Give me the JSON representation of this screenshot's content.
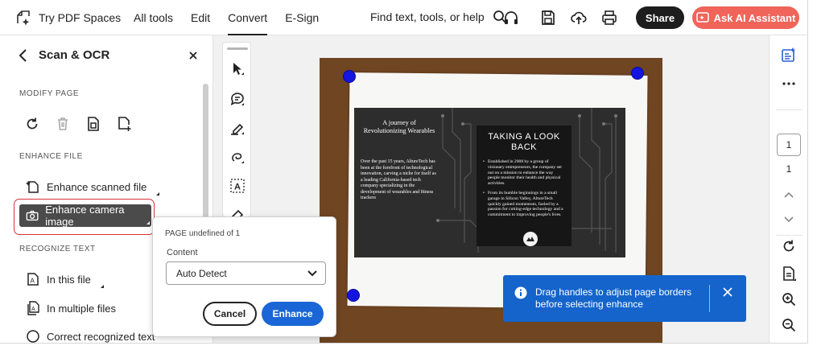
{
  "app": {
    "brand_label": "Try PDF Spaces",
    "nav": [
      "All tools",
      "Edit",
      "Convert",
      "E-Sign"
    ],
    "active_nav": "Convert",
    "find_label": "Find text, tools, or help",
    "share_label": "Share",
    "ai_label": "Ask AI Assistant",
    "ai_color": "#f0645a"
  },
  "panel": {
    "title": "Scan & OCR",
    "sections": {
      "modify": "MODIFY PAGE",
      "enhance": "ENHANCE FILE",
      "recognize": "RECOGNIZE TEXT"
    },
    "enhance_items": [
      "Enhance scanned file",
      "Enhance camera image"
    ],
    "recognize_items": [
      "In this file",
      "In multiple files",
      "Correct recognized text"
    ]
  },
  "popover": {
    "page_label": "PAGE undefined of 1",
    "content_label": "Content",
    "content_value": "Auto Detect",
    "cancel_label": "Cancel",
    "enhance_label": "Enhance",
    "accent_color": "#1a66d6"
  },
  "toast": {
    "message": "Drag handles to adjust page borders before selecting enhance",
    "color": "#1464cc"
  },
  "pagenav": {
    "current_page": "1",
    "total_pages": "1"
  },
  "document": {
    "left_title": "A journey of Revolutionizing Wearables",
    "left_body": "Over the past 15 years, AltureTech has been at the forefront of technological innovation, carving a niche for itself as a leading California-based tech company specializing in the development of wearables and fitness trackers",
    "right_heading": "TAKING A LOOK BACK",
    "right_items": [
      "Established in 2008 by a group of visionary entrepreneurs, the company set out on a mission to enhance the way people monitor their health and physical activities.",
      "From its humble beginnings in a small garage in Silicon Valley, AltureTech quickly gained momentum, fueled by a passion for cutting-edge technology and a commitment to improving people's lives."
    ]
  },
  "icons": {
    "handle_color": "#1515e0",
    "selection_ring": "#d8323a"
  }
}
